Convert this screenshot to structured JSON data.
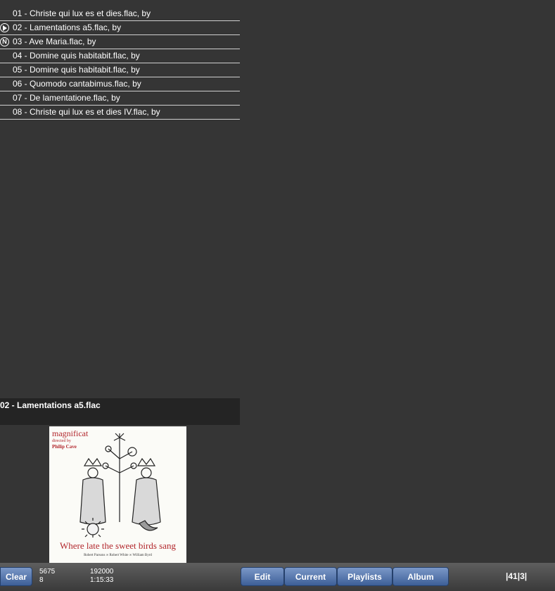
{
  "playlist": {
    "tracks": [
      {
        "label": "01 - Christe qui lux es et dies.flac, by",
        "marker": ""
      },
      {
        "label": "02 - Lamentations a5.flac, by",
        "marker": "play"
      },
      {
        "label": "03 - Ave Maria.flac, by",
        "marker": "N"
      },
      {
        "label": "04 - Domine quis habitabit.flac, by",
        "marker": ""
      },
      {
        "label": "05 - Domine quis habitabit.flac, by",
        "marker": ""
      },
      {
        "label": "06 - Quomodo cantabimus.flac, by",
        "marker": ""
      },
      {
        "label": "07 - De lamentatione.flac, by",
        "marker": ""
      },
      {
        "label": "08 - Christe qui lux es et dies IV.flac, by",
        "marker": ""
      }
    ]
  },
  "now_playing": {
    "title": "02 - Lamentations a5.flac"
  },
  "album_art": {
    "brand": "magnificat",
    "subtitle_line1": "directed by",
    "subtitle_line2": "Philip Cave",
    "title": "Where late the sweet birds sang",
    "credits": "Robert Parsons ∞ Robert White ∞ William Byrd"
  },
  "bottom_bar": {
    "clear_label": "Clear",
    "stat_count": "5675",
    "stat_count2": "8",
    "stat_size": "192000",
    "stat_duration": "1:15:33",
    "edit_label": "Edit",
    "current_label": "Current",
    "playlists_label": "Playlists",
    "album_label": "Album",
    "pager": "|41|3|"
  },
  "colors": {
    "background": "#353535",
    "button": "#4a6ca4",
    "art_red": "#b2262c"
  }
}
